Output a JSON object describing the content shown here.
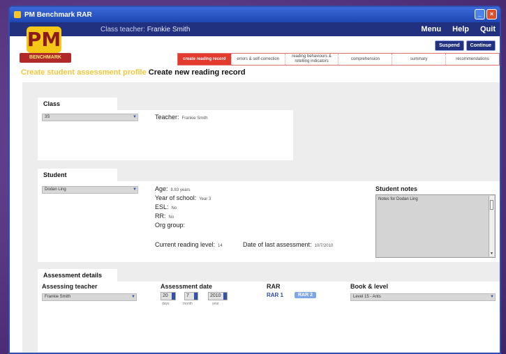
{
  "window": {
    "title": "PM Benchmark RAR"
  },
  "header": {
    "teacher_label": "Class teacher:",
    "teacher_name": "Frankie Smith",
    "menu": [
      "Menu",
      "Help",
      "Quit"
    ],
    "actions": [
      "Suspend",
      "Continue"
    ]
  },
  "logo": {
    "main": "PM",
    "sub": "BENCHMARK"
  },
  "steps": [
    {
      "label": "create reading record",
      "active": true
    },
    {
      "label": "errors & self-correction",
      "active": false
    },
    {
      "label": "reading behaviours & retelling indicators",
      "active": false
    },
    {
      "label": "comprehension",
      "active": false
    },
    {
      "label": "summary",
      "active": false
    },
    {
      "label": "recommendations",
      "active": false
    }
  ],
  "heading": {
    "prefix": "Create student assessment profile",
    "title": "Create new reading record"
  },
  "class_section": {
    "tab": "Class",
    "select_value": "3S",
    "teacher_label": "Teacher:",
    "teacher_value": "Frankie Smith"
  },
  "student_section": {
    "tab": "Student",
    "select_value": "Dodan Ling",
    "age_label": "Age:",
    "age_value": "8.83 years",
    "year_label": "Year of school:",
    "year_value": "Year 3",
    "esl_label": "ESL:",
    "esl_value": "No",
    "rr_label": "RR:",
    "rr_value": "No",
    "org_label": "Org group:",
    "level_label": "Current reading level:",
    "level_value": "14",
    "last_label": "Date of last assessment:",
    "last_value": "10/7/2010",
    "notes_label": "Student notes",
    "notes_value": "Notes for Dodan Ling"
  },
  "assessment_section": {
    "tab": "Assessment details",
    "teacher_label": "Assessing teacher",
    "teacher_value": "Frankie Smith",
    "date_label": "Assessment date",
    "day": "20",
    "month": "7",
    "year": "2010",
    "day_cap": "days",
    "month_cap": "month",
    "year_cap": "year",
    "rar_label": "RAR",
    "rar1": "RAR 1",
    "rar2": "RAR 2",
    "book_label": "Book & level",
    "book_value": "Level 15 - Ants"
  }
}
